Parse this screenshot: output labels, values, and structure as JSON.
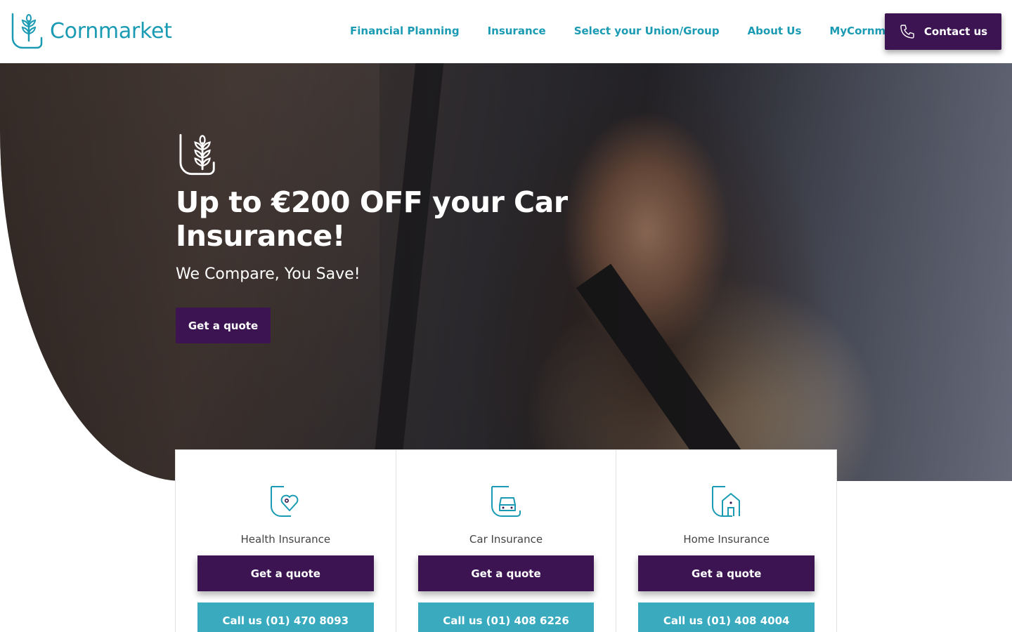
{
  "brand": {
    "name": "Cornmarket",
    "primary": "#1a9bb3",
    "accent": "#3d1452",
    "call_color": "#3aaabf"
  },
  "nav": {
    "items": [
      {
        "label": "Financial Planning"
      },
      {
        "label": "Insurance"
      },
      {
        "label": "Select your Union/Group"
      },
      {
        "label": "About Us"
      },
      {
        "label": "MyCornmarket"
      }
    ],
    "contact_label": "Contact us",
    "contact_icon": "phone-icon"
  },
  "hero": {
    "icon": "wheat-shield-icon",
    "title": "Up to €200 OFF your Car Insurance!",
    "subtitle": "We Compare, You Save!",
    "cta_label": "Get a quote"
  },
  "cards": [
    {
      "icon": "heart-shield-icon",
      "title": "Health Insurance",
      "quote_label": "Get a quote",
      "call_label": "Call us (01) 470 8093"
    },
    {
      "icon": "car-shield-icon",
      "title": "Car Insurance",
      "quote_label": "Get a quote",
      "call_label": "Call us (01) 408 6226"
    },
    {
      "icon": "house-shield-icon",
      "title": "Home Insurance",
      "quote_label": "Get a quote",
      "call_label": "Call us (01) 408 4004"
    }
  ]
}
